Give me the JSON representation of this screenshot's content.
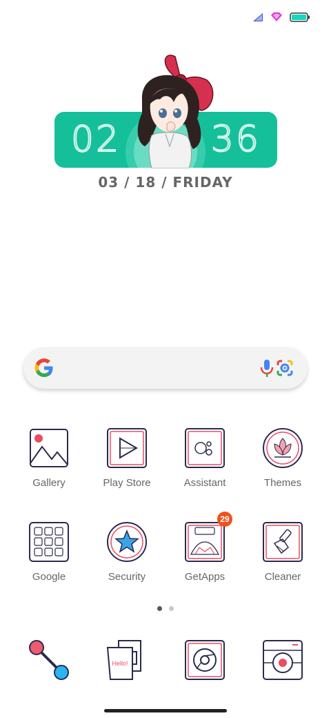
{
  "status_bar": {
    "signal_icon": "signal-icon",
    "wifi_icon": "wifi-icon",
    "battery_icon": "battery-icon",
    "battery_level": 1.0,
    "accent": "#17d7c0"
  },
  "clock_widget": {
    "hours": "02",
    "minutes": "36",
    "date": "03 / 18 / FRIDAY",
    "background": "#15bf9a"
  },
  "search_bar": {
    "logo": "google-g-icon",
    "mic_icon": "microphone-icon",
    "lens_icon": "google-lens-icon"
  },
  "apps": [
    {
      "label": "Gallery",
      "icon": "gallery-icon"
    },
    {
      "label": "Play Store",
      "icon": "play-store-icon"
    },
    {
      "label": "Assistant",
      "icon": "assistant-icon"
    },
    {
      "label": "Themes",
      "icon": "themes-icon"
    },
    {
      "label": "Google",
      "icon": "google-folder-icon"
    },
    {
      "label": "Security",
      "icon": "security-icon"
    },
    {
      "label": "GetApps",
      "icon": "getapps-icon",
      "badge": "29"
    },
    {
      "label": "Cleaner",
      "icon": "cleaner-icon"
    }
  ],
  "page_indicator": {
    "pages": 2,
    "current": 1
  },
  "dock": [
    {
      "icon": "phone-icon"
    },
    {
      "icon": "messages-icon",
      "text": "Hello!"
    },
    {
      "icon": "chrome-icon"
    },
    {
      "icon": "camera-icon"
    }
  ]
}
